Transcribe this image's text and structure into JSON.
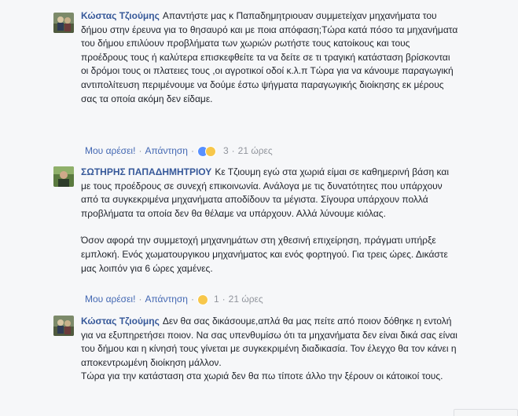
{
  "comments": [
    {
      "author": "Κώστας Τζιούμης",
      "paragraphs": [
        "Απαντήστε μας κ Παπαδημητριουαν συμμετείχαν μηχανήματα του δήμου στην έρευνα για το θησαυρό και με ποια απόφαση;Τώρα κατά πόσο τα μηχανήματα του δήμου επιλύουν προβλήματα των χωριών ρωτήστε τους κατοίκους και τους προέδρους τους ή καλύτερα επισκεφθείτε τα να δείτε σε τι τραγική κατάσταση βρίσκονται οι δρόμοι τους οι πλατειες τους ,οι αγροτικοί οδοί κ.λ.π Τώρα για να κάνουμε παραγωγική αντιπολίτευση περιμένουμε να δούμε έστω ψήγματα παραγωγικής διοίκησης εκ μέρους σας τα οποία ακόμη δεν είδαμε."
      ],
      "actions": {
        "like": "Μου αρέσει!",
        "reply": "Απάντηση",
        "reaction_count": "3",
        "time": "21 ώρες"
      },
      "reactions": [
        "like-reaction",
        "wow-reaction"
      ]
    },
    {
      "author": "ΣΩΤΗΡΗΣ ΠΑΠΑΔΗΜΗΤΡΙΟΥ",
      "paragraphs": [
        "Κε Τζιουμη εγώ στα χωριά είμαι σε καθημερινή βάση και με τους προέδρους σε συνεχή επικοινωνία. Ανάλογα με τις δυνατότητες που υπάρχουν από τα συγκεκριμένα μηχανήματα αποδίδουν τα μέγιστα. Σίγουρα υπάρχουν πολλά προβλήματα τα οποία δεν θα θέλαμε να υπάρχουν. Αλλά λύνουμε κιόλας.",
        "Όσον αφορά την συμμετοχή μηχανημάτων στη χθεσινή επιχείρηση, πράγματι υπήρξε εμπλοκή. Ενός χωματουργικου μηχανήματος και ενός φορτηγού. Για τρεις ώρες. Δικάστε μας λοιπόν για 6 ώρες χαμένες."
      ],
      "actions": {
        "like": "Μου αρέσει!",
        "reply": "Απάντηση",
        "reaction_count": "1",
        "time": "21 ώρες"
      },
      "reactions": [
        "haha-reaction"
      ]
    },
    {
      "author": "Κώστας Τζιούμης",
      "paragraphs": [
        "Δεν θα σας δικάσουμε,απλά θα μας πείτε από ποιον δόθηκε η εντολή για να εξυπηρετήσει ποιον. Να σας υπενθυμίσω ότι τα μηχανήματα δεν είναι δικά σας είναι του δήμου και η κίνησή τους γίνεται με συγκεκριμένη διαδικασία. Τον έλεγχο θα τον κάνει η αποκεντρωμένη διοίκηση μάλλον.",
        "Τώρα για την κατάσταση στα χωριά δεν θα πω τίποτε άλλο την ξέρουν οι κάτοικοί τους."
      ]
    }
  ],
  "colors": {
    "author": "#365899",
    "link": "#4267b2",
    "meta": "#90949c",
    "text": "#1d2129",
    "background": "#f6f7f9"
  }
}
